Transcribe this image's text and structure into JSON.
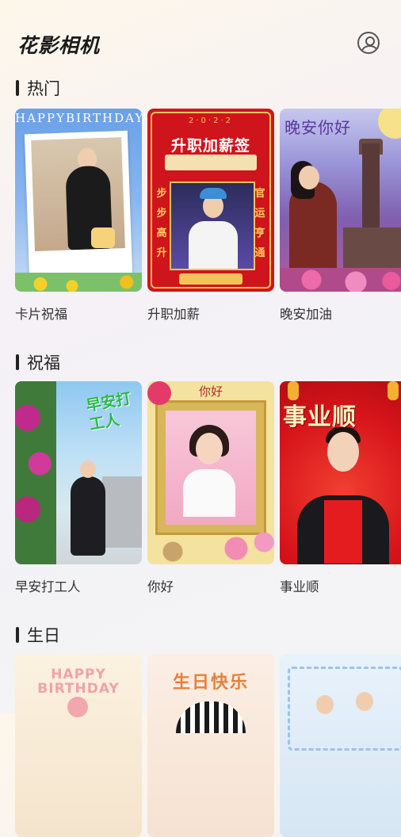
{
  "app": {
    "title": "花影相机"
  },
  "sections": [
    {
      "title": "热门",
      "cards": [
        {
          "label": "卡片祝福",
          "banner": "HAPPYBIRTHDAY"
        },
        {
          "label": "升职加薪",
          "year": "2·0·2·2",
          "title": "升职加薪签",
          "side_left": "步步高升",
          "side_right": "官运亨通"
        },
        {
          "label": "晚安加油",
          "title": "晚安你好"
        }
      ]
    },
    {
      "title": "祝福",
      "cards": [
        {
          "label": "早安打工人",
          "title": "早安打工人"
        },
        {
          "label": "你好",
          "title": "你好"
        },
        {
          "label": "事业顺",
          "title": "事业顺"
        }
      ]
    },
    {
      "title": "生日",
      "cards": [
        {
          "line1": "HAPPY",
          "line2": "BIRTHDAY"
        },
        {
          "title": "生日快乐"
        },
        {}
      ]
    }
  ],
  "icons": {
    "profile": "user-circle-icon"
  },
  "colors": {
    "accent_red": "#d0141b",
    "gold": "#f4c45a"
  }
}
